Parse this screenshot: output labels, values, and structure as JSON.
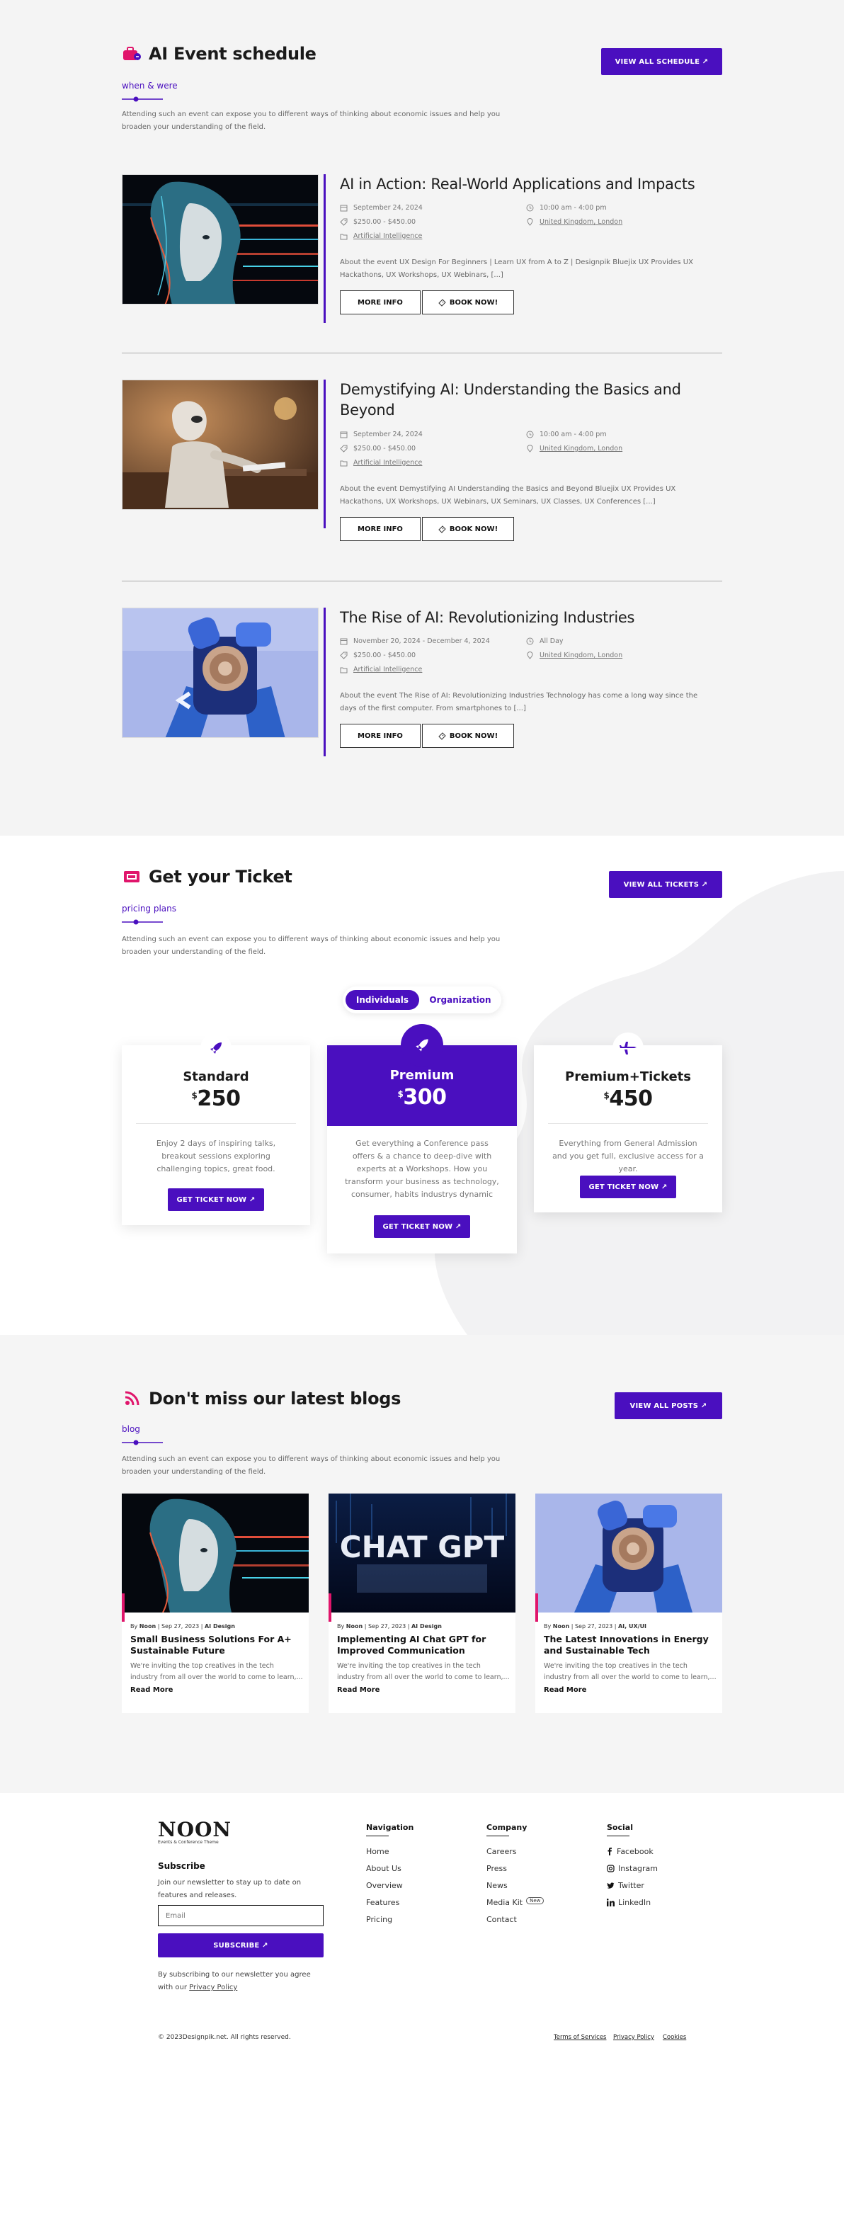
{
  "schedule": {
    "title": "AI Event schedule",
    "subtitle": "when & were",
    "description": "Attending such an event can expose you to different ways of thinking about economic issues and help you broaden your understanding of the field.",
    "view_all": "VIEW ALL SCHEDULE ↗",
    "more_info": "MORE INFO",
    "book_now": "BOOK NOW!",
    "events": [
      {
        "title": "AI in Action: Real-World Applications and Impacts",
        "date": "September 24, 2024",
        "time": "10:00 am - 4:00 pm",
        "price": "$250.00 - $450.00",
        "location": "United Kingdom, London",
        "category": "Artificial Intelligence",
        "description": "About the event UX Design For Beginners | Learn UX from A to Z | Designpik Bluejix UX Provides UX Hackathons, UX Workshops, UX Webinars, [...]"
      },
      {
        "title": "Demystifying AI: Understanding the Basics and Beyond",
        "date": "September 24, 2024",
        "time": "10:00 am - 4:00 pm",
        "price": "$250.00 - $450.00",
        "location": "United Kingdom, London",
        "category": "Artificial Intelligence",
        "description": "About the event Demystifying AI Understanding the Basics and Beyond Bluejix UX Provides UX Hackathons, UX Workshops, UX Webinars, UX Seminars, UX Classes, UX Conferences [...]"
      },
      {
        "title": "The Rise of AI: Revolutionizing Industries",
        "date": "November 20, 2024 - December 4, 2024",
        "time": "All Day",
        "price": "$250.00 - $450.00",
        "location": "United Kingdom, London",
        "category": "Artificial Intelligence",
        "description": "About the event The Rise of AI: Revolutionizing Industries Technology has come a long way since the days of the first computer. From smartphones to [...]"
      }
    ]
  },
  "tickets": {
    "title": "Get your Ticket",
    "subtitle": "pricing plans",
    "description": "Attending such an event can expose you to different ways of thinking about economic issues and help you broaden your understanding of the field.",
    "view_all": "VIEW ALL TICKETS ↗",
    "toggle": [
      "Individuals",
      "Organization"
    ],
    "cta": "GET TICKET NOW ↗",
    "currency": "$",
    "plans": [
      {
        "name": "Standard",
        "price": "250",
        "description": "Enjoy 2 days of inspiring talks, breakout sessions exploring challenging topics, great food."
      },
      {
        "name": "Premium",
        "price": "300",
        "description": "Get everything a Conference pass offers & a chance to deep-dive with experts at a Workshops. How you transform your business as technology, consumer, habits industrys dynamic"
      },
      {
        "name": "Premium+Tickets",
        "price": "450",
        "description": "Everything from General Admission and you get full, exclusive access for a year."
      }
    ]
  },
  "blogs": {
    "title": "Don't miss our latest blogs",
    "subtitle": "blog",
    "description": "Attending such an event can expose you to different ways of thinking about economic issues and help you broaden your understanding of the field.",
    "view_all": "VIEW ALL POSTS ↗",
    "read_more": "Read More",
    "chat_gpt_image_text": "CHAT GPT",
    "posts": [
      {
        "by": "By",
        "author": "Noon",
        "date": "Sep 27, 2023",
        "category": "AI Design",
        "title": "Small Business Solutions For A+ Sustainable Future",
        "excerpt": "We're inviting the top creatives in the tech industry from all over the world to come to learn,..."
      },
      {
        "by": "By",
        "author": "Noon",
        "date": "Sep 27, 2023",
        "category": "AI Design",
        "title": "Implementing AI Chat GPT for Improved Communication",
        "excerpt": "We're inviting the top creatives in the tech industry from all over the world to come to learn,..."
      },
      {
        "by": "By",
        "author": "Noon",
        "date": "Sep 27, 2023",
        "category": "AI, UX/UI",
        "title": "The Latest Innovations in Energy and Sustainable Tech",
        "excerpt": "We're inviting the top creatives in the tech industry from all over the world to come to learn,..."
      }
    ]
  },
  "footer": {
    "logo": "NOON",
    "logo_tagline": "Events & Conference Theme",
    "subscribe_title": "Subscribe",
    "subscribe_text": "Join our newsletter to stay up to date on features and releases.",
    "email_placeholder": "Email",
    "subscribe_button": "SUBSCRIBE ↗",
    "consent_text": "By subscribing to our newsletter you agree with our",
    "privacy_link": "Privacy Policy",
    "navigation_title": "Navigation",
    "navigation": [
      "Home",
      "About Us",
      "Overview",
      "Features",
      "Pricing"
    ],
    "company_title": "Company",
    "company": [
      "Careers",
      "Press",
      "News",
      "Media Kit",
      "Contact"
    ],
    "new_badge": "New",
    "social_title": "Social",
    "social": [
      "Facebook",
      "Instagram",
      "Twitter",
      "LinkedIn"
    ],
    "copyright": "© 2023Designpik.net. All rights reserved.",
    "legal": [
      "Terms of Services",
      "Privacy Policy",
      "Cookies"
    ]
  },
  "colors": {
    "accent": "#4a0fbf",
    "pink": "#e0156b"
  }
}
